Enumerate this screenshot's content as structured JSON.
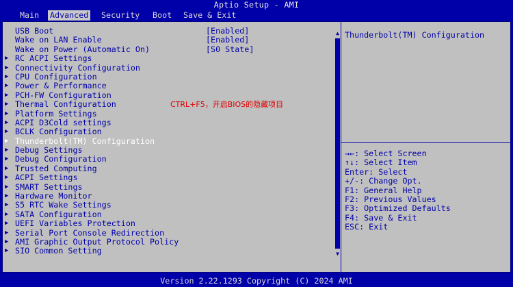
{
  "header": {
    "title": "Aptio Setup - AMI"
  },
  "menu": [
    {
      "label": "Main",
      "active": false
    },
    {
      "label": "Advanced",
      "active": true
    },
    {
      "label": "Security",
      "active": false
    },
    {
      "label": "Boot",
      "active": false
    },
    {
      "label": "Save & Exit",
      "active": false
    }
  ],
  "settings": [
    {
      "label": "USB Boot",
      "value": "[Enabled]"
    },
    {
      "label": "Wake on LAN Enable",
      "value": "[Enabled]"
    },
    {
      "label": "Wake on Power (Automatic On)",
      "value": "[S0 State]"
    }
  ],
  "submenus": [
    {
      "label": "RC ACPI Settings"
    },
    {
      "label": "Connectivity Configuration"
    },
    {
      "label": "CPU Configuration"
    },
    {
      "label": "Power & Performance"
    },
    {
      "label": "PCH-FW Configuration"
    },
    {
      "label": "Thermal Configuration"
    },
    {
      "label": "Platform Settings"
    },
    {
      "label": "ACPI D3Cold settings"
    },
    {
      "label": "BCLK Configuration"
    },
    {
      "label": "Thunderbolt(TM) Configuration",
      "selected": true
    },
    {
      "label": "Debug Settings"
    },
    {
      "label": "Debug Configuration"
    },
    {
      "label": "Trusted Computing"
    },
    {
      "label": "ACPI Settings"
    },
    {
      "label": "SMART Settings"
    },
    {
      "label": "Hardware Monitor"
    },
    {
      "label": "S5 RTC Wake Settings"
    },
    {
      "label": "SATA Configuration"
    },
    {
      "label": "UEFI Variables Protection"
    },
    {
      "label": "Serial Port Console Redirection"
    },
    {
      "label": "AMI Graphic Output Protocol Policy"
    },
    {
      "label": "SIO Common Setting"
    }
  ],
  "note": "CTRL+F5，开启BIOS的隐藏项目",
  "help": {
    "title": "Thunderbolt(TM) Configuration"
  },
  "keys": [
    "→←: Select Screen",
    "↑↓: Select Item",
    "Enter: Select",
    "+/-: Change Opt.",
    "F1: General Help",
    "F2: Previous Values",
    "F3: Optimized Defaults",
    "F4: Save & Exit",
    "ESC: Exit"
  ],
  "icons": {
    "submenu": "submenu-arrow-icon",
    "scroll_up": "scroll-up-arrow-icon",
    "scroll_down": "scroll-down-arrow-icon"
  },
  "colors": {
    "background": "#0000a8",
    "panel": "#c0c0c0",
    "highlight_text": "#ffffff",
    "note": "#e00000"
  },
  "footer": {
    "version": "Version 2.22.1293 Copyright (C) 2024 AMI"
  }
}
